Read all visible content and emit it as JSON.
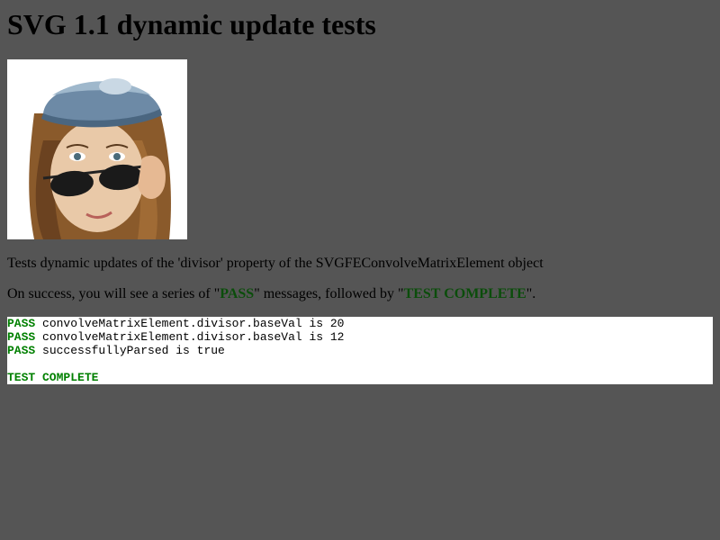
{
  "page": {
    "title": "SVG 1.1 dynamic update tests",
    "description": "Tests dynamic updates of the 'divisor' property of the SVGFEConvolveMatrixElement object",
    "success_prefix": "On success, you will see a series of \"",
    "success_pass_word": "PASS",
    "success_middle": "\" messages, followed by \"",
    "success_complete_word": "TEST COMPLETE",
    "success_suffix": "\"."
  },
  "console": {
    "lines": [
      {
        "status": "PASS",
        "message": " convolveMatrixElement.divisor.baseVal is 20"
      },
      {
        "status": "PASS",
        "message": " convolveMatrixElement.divisor.baseVal is 12"
      },
      {
        "status": "PASS",
        "message": " successfullyParsed is true"
      }
    ],
    "complete": "TEST COMPLETE"
  },
  "colors": {
    "background": "#555555",
    "pass": "#008000",
    "highlight": "#0b4d0b"
  }
}
